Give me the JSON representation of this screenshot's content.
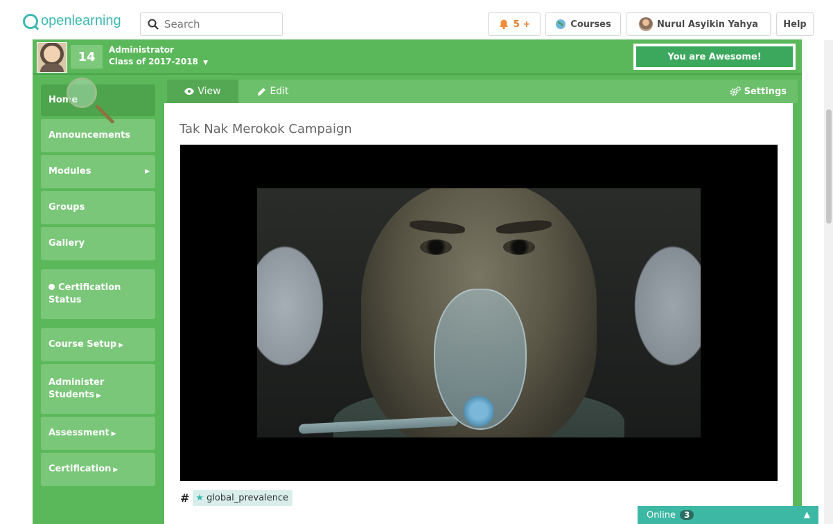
{
  "header": {
    "logo_text": "openlearning",
    "search_placeholder": "Search",
    "notifications_label": "5 +",
    "courses_label": "Courses",
    "user_name": "Nurul Asyikin Yahya",
    "help_label": "Help"
  },
  "banner": {
    "level": "14",
    "role": "Administrator",
    "class_label": "Class of 2017-2018",
    "awesome_label": "You are Awesome!"
  },
  "sidebar": {
    "items": [
      {
        "label": "Home"
      },
      {
        "label": "Announcements"
      },
      {
        "label": "Modules"
      },
      {
        "label": "Groups"
      },
      {
        "label": "Gallery"
      },
      {
        "label": "Certification Status"
      },
      {
        "label": "Course Setup"
      },
      {
        "label": "Administer Students"
      },
      {
        "label": "Assessment"
      },
      {
        "label": "Certification"
      }
    ]
  },
  "tabs": {
    "view_label": "View",
    "edit_label": "Edit",
    "settings_label": "Settings"
  },
  "content": {
    "title": "Tak Nak Merokok Campaign",
    "tag_symbol": "#",
    "tag": "global_prevalence"
  },
  "online": {
    "label": "Online",
    "count": "3"
  },
  "colors": {
    "brand_teal": "#3cb8b0",
    "nav_green": "#5bb85a",
    "nav_item": "#7ac779",
    "awesome_bg": "#3ca85e",
    "online_bar": "#3cb8a4"
  }
}
